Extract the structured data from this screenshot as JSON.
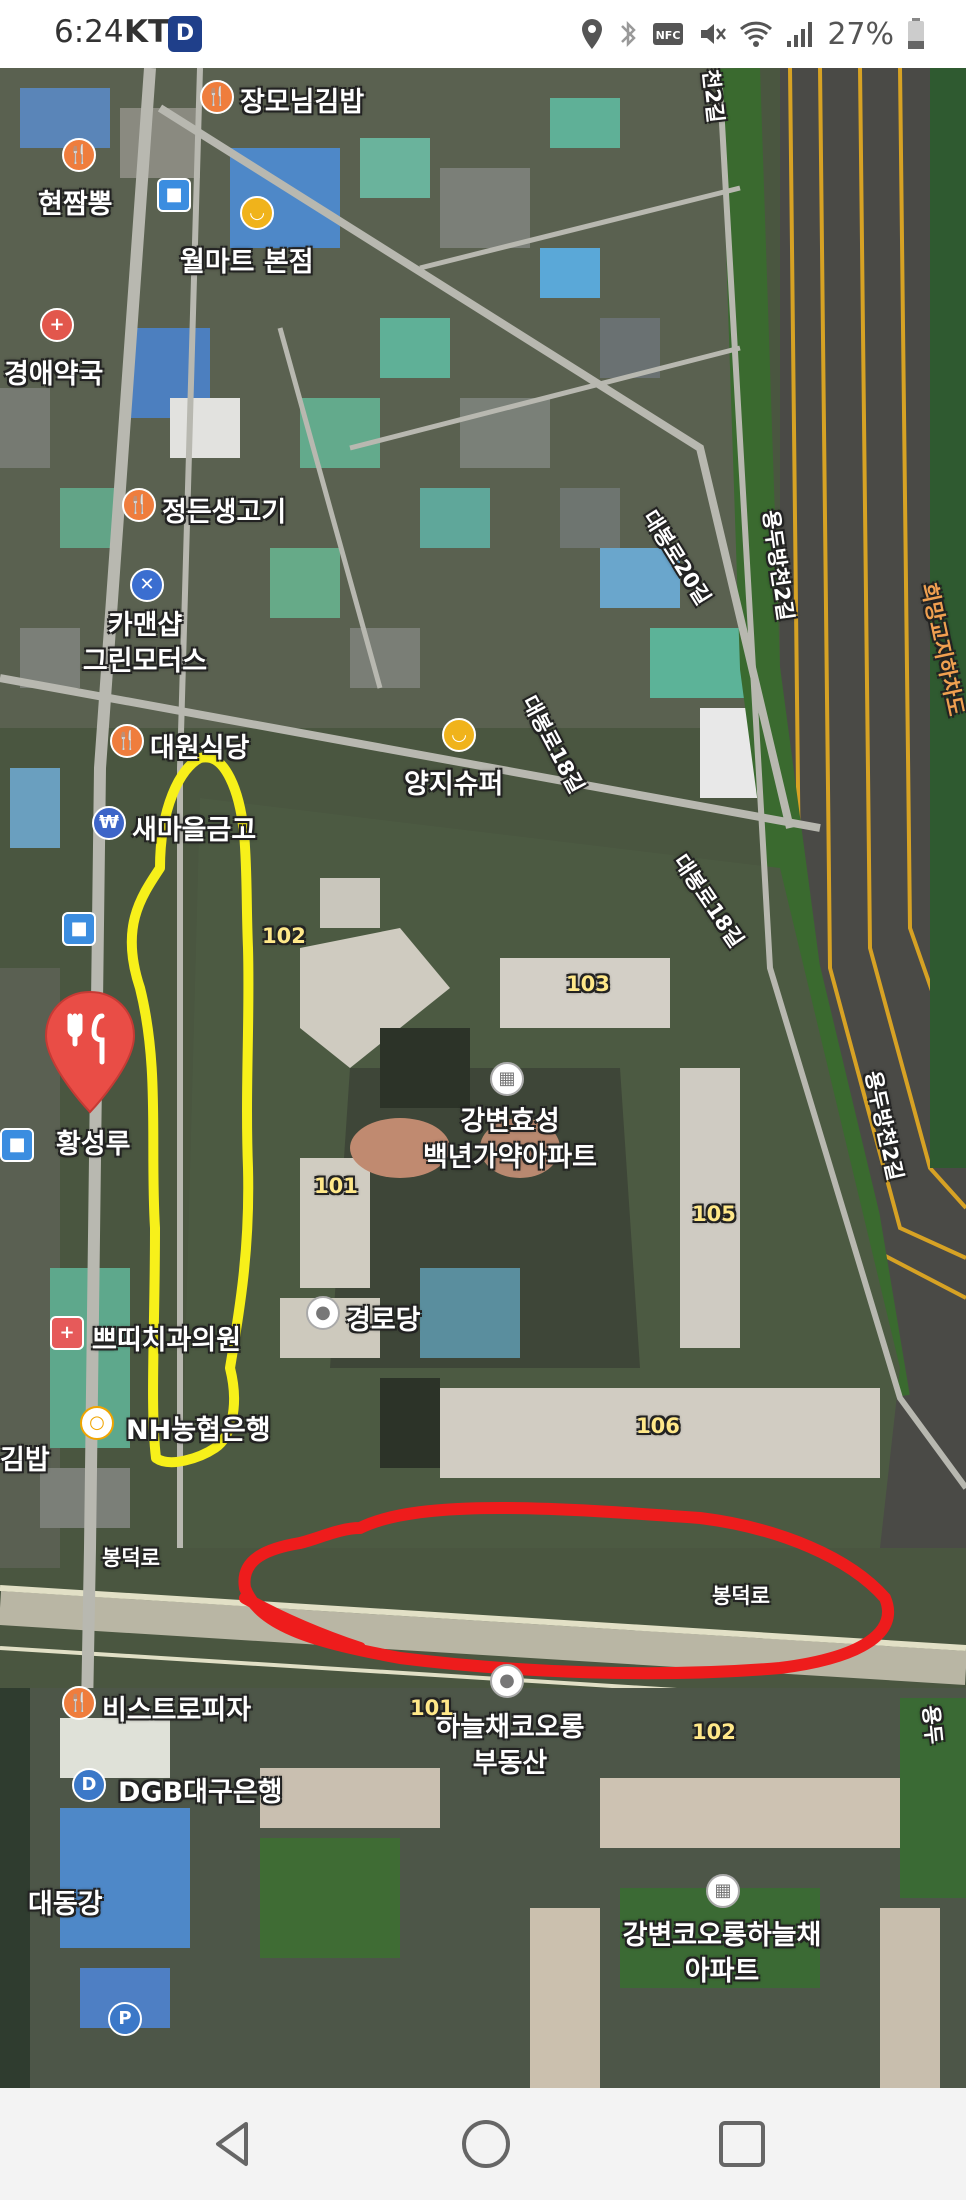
{
  "status_bar": {
    "time": "6:24",
    "carrier": "KT",
    "carrier_badge": "D",
    "battery": "27%",
    "icons": [
      "location-icon",
      "bluetooth-icon",
      "nfc-icon",
      "mute-icon",
      "wifi-icon",
      "signal-icon",
      "battery-icon"
    ]
  },
  "map": {
    "places": {
      "jangmonim": "장모님김밥",
      "hyeonjjam": "현짬뽕",
      "wolmart": "월마트 본점",
      "kyungae": "경애약국",
      "jeongdeun": "정든생고기",
      "carman_1": "카맨샵",
      "carman_2": "그린모터스",
      "daewon": "대원식당",
      "yangji": "양지슈퍼",
      "saemaeul": "새마을금고",
      "hwangseong": "황성루",
      "dental": "쁘띠치과의원",
      "nh": "NH농협은행",
      "gimbap_left": "김밥",
      "apt_1": "강변효성",
      "apt_2": "백년가약아파트",
      "senior": "경로당",
      "bistro": "비스트로피자",
      "dgb": "DGB대구은행",
      "daedong": "대동강",
      "realty_1": "하늘채코오롱",
      "realty_2": "부동산",
      "apt2_1": "강변코오롱하늘채",
      "apt2_2": "아파트"
    },
    "buildings": [
      "102",
      "103",
      "101",
      "105",
      "106",
      "101",
      "102"
    ],
    "roads": {
      "daebong20": "대봉로20길",
      "daebong18a": "대봉로18길",
      "daebong18b": "대봉로18길",
      "yongdu_top": "용두방천2길",
      "yongdu_mid": "용두방천2길",
      "yongdu_right": "용두방천2길",
      "huimang": "희망교지하차도",
      "bongdeok": "봉덕로",
      "bongdeok_right": "봉덕로",
      "top_cut": "천2길",
      "edge": "용두"
    }
  },
  "annotations": {
    "yellow_color": "#f7f01a",
    "red_color": "#ee1c1c"
  },
  "nav": {
    "back": "back-icon",
    "home": "home-icon",
    "recents": "recents-icon"
  }
}
